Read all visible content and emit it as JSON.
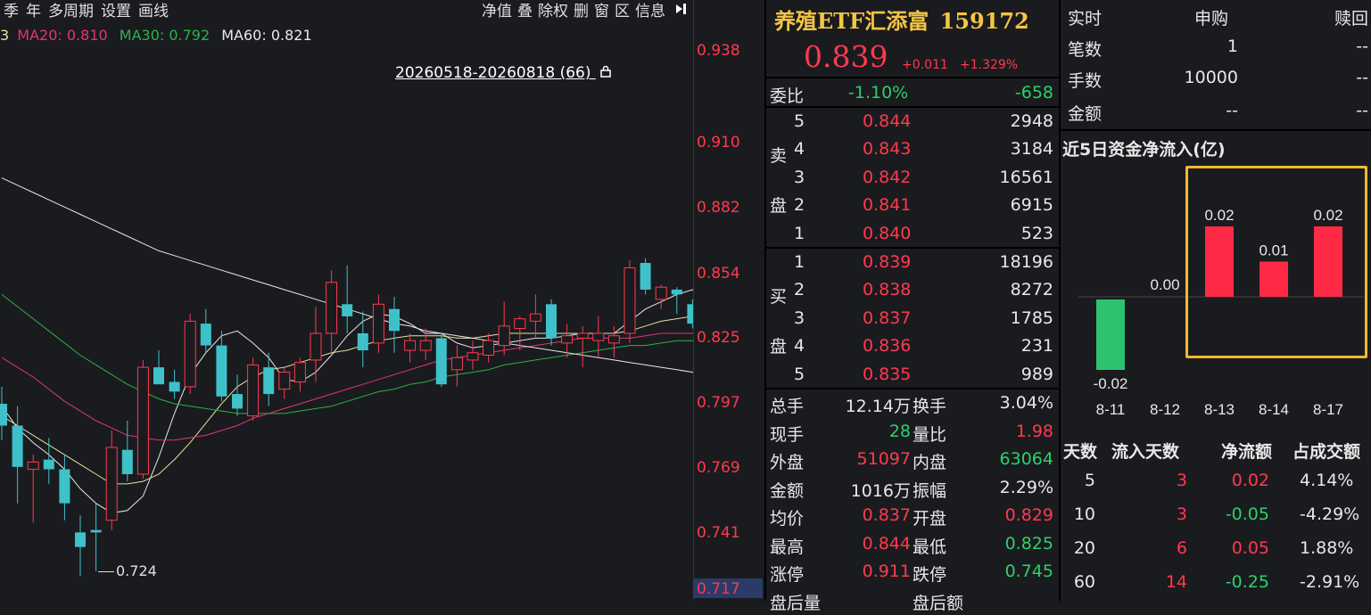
{
  "toolbar": {
    "left_items": [
      "季",
      "年",
      "多周期",
      "设置",
      "画线"
    ],
    "right_items": [
      "净值",
      "叠",
      "除权",
      "删",
      "窗",
      "区",
      "信息"
    ]
  },
  "ma": {
    "ma_prefix": "3",
    "ma20": "MA20: 0.810",
    "ma30": "MA30: 0.792",
    "ma60": "MA60: 0.821"
  },
  "chart": {
    "range_label": "20260518-20260818 (66)",
    "low_label": "0.724",
    "y_ticks": [
      "0.938",
      "0.910",
      "0.882",
      "0.854",
      "0.825",
      "0.797",
      "0.769",
      "0.741",
      "0.717"
    ]
  },
  "chart_data": {
    "type": "candlestick",
    "ylim": [
      0.717,
      0.945
    ],
    "candles": [
      {
        "o": 0.793,
        "h": 0.8,
        "l": 0.778,
        "c": 0.784
      },
      {
        "o": 0.784,
        "h": 0.792,
        "l": 0.752,
        "c": 0.767
      },
      {
        "o": 0.766,
        "h": 0.772,
        "l": 0.744,
        "c": 0.769
      },
      {
        "o": 0.77,
        "h": 0.779,
        "l": 0.76,
        "c": 0.766
      },
      {
        "o": 0.766,
        "h": 0.772,
        "l": 0.745,
        "c": 0.752
      },
      {
        "o": 0.74,
        "h": 0.747,
        "l": 0.722,
        "c": 0.734
      },
      {
        "o": 0.741,
        "h": 0.752,
        "l": 0.724,
        "c": 0.74
      },
      {
        "o": 0.745,
        "h": 0.782,
        "l": 0.741,
        "c": 0.775
      },
      {
        "o": 0.774,
        "h": 0.786,
        "l": 0.761,
        "c": 0.764
      },
      {
        "o": 0.764,
        "h": 0.811,
        "l": 0.762,
        "c": 0.808
      },
      {
        "o": 0.808,
        "h": 0.815,
        "l": 0.802,
        "c": 0.801
      },
      {
        "o": 0.802,
        "h": 0.807,
        "l": 0.795,
        "c": 0.798
      },
      {
        "o": 0.8,
        "h": 0.83,
        "l": 0.797,
        "c": 0.827
      },
      {
        "o": 0.826,
        "h": 0.832,
        "l": 0.814,
        "c": 0.817
      },
      {
        "o": 0.817,
        "h": 0.823,
        "l": 0.794,
        "c": 0.796
      },
      {
        "o": 0.797,
        "h": 0.805,
        "l": 0.788,
        "c": 0.791
      },
      {
        "o": 0.788,
        "h": 0.812,
        "l": 0.786,
        "c": 0.809
      },
      {
        "o": 0.808,
        "h": 0.814,
        "l": 0.792,
        "c": 0.797
      },
      {
        "o": 0.799,
        "h": 0.808,
        "l": 0.795,
        "c": 0.806
      },
      {
        "o": 0.802,
        "h": 0.812,
        "l": 0.798,
        "c": 0.81
      },
      {
        "o": 0.811,
        "h": 0.833,
        "l": 0.802,
        "c": 0.822
      },
      {
        "o": 0.822,
        "h": 0.848,
        "l": 0.813,
        "c": 0.843
      },
      {
        "o": 0.834,
        "h": 0.85,
        "l": 0.822,
        "c": 0.829
      },
      {
        "o": 0.822,
        "h": 0.831,
        "l": 0.808,
        "c": 0.815
      },
      {
        "o": 0.818,
        "h": 0.838,
        "l": 0.814,
        "c": 0.834
      },
      {
        "o": 0.832,
        "h": 0.837,
        "l": 0.814,
        "c": 0.823
      },
      {
        "o": 0.815,
        "h": 0.822,
        "l": 0.81,
        "c": 0.819
      },
      {
        "o": 0.815,
        "h": 0.824,
        "l": 0.811,
        "c": 0.819
      },
      {
        "o": 0.82,
        "h": 0.822,
        "l": 0.8,
        "c": 0.801
      },
      {
        "o": 0.807,
        "h": 0.817,
        "l": 0.8,
        "c": 0.812
      },
      {
        "o": 0.811,
        "h": 0.819,
        "l": 0.807,
        "c": 0.814
      },
      {
        "o": 0.813,
        "h": 0.822,
        "l": 0.81,
        "c": 0.819
      },
      {
        "o": 0.817,
        "h": 0.835,
        "l": 0.813,
        "c": 0.825
      },
      {
        "o": 0.824,
        "h": 0.829,
        "l": 0.815,
        "c": 0.828
      },
      {
        "o": 0.827,
        "h": 0.838,
        "l": 0.82,
        "c": 0.83
      },
      {
        "o": 0.834,
        "h": 0.836,
        "l": 0.817,
        "c": 0.82
      },
      {
        "o": 0.818,
        "h": 0.826,
        "l": 0.812,
        "c": 0.821
      },
      {
        "o": 0.82,
        "h": 0.825,
        "l": 0.808,
        "c": 0.822
      },
      {
        "o": 0.819,
        "h": 0.829,
        "l": 0.812,
        "c": 0.822
      },
      {
        "o": 0.818,
        "h": 0.825,
        "l": 0.812,
        "c": 0.821
      },
      {
        "o": 0.822,
        "h": 0.852,
        "l": 0.818,
        "c": 0.849
      },
      {
        "o": 0.851,
        "h": 0.853,
        "l": 0.838,
        "c": 0.84
      },
      {
        "o": 0.836,
        "h": 0.842,
        "l": 0.832,
        "c": 0.841
      },
      {
        "o": 0.84,
        "h": 0.841,
        "l": 0.83,
        "c": 0.838
      },
      {
        "o": 0.834,
        "h": 0.836,
        "l": 0.824,
        "c": 0.826
      },
      {
        "o": 0.825,
        "h": 0.833,
        "l": 0.82,
        "c": 0.829
      },
      {
        "o": 0.829,
        "h": 0.847,
        "l": 0.825,
        "c": 0.839
      }
    ],
    "ma_lines": [
      {
        "name": "MA5",
        "color": "#e8e8e8",
        "values": [
          0.792,
          0.783,
          0.777,
          0.772,
          0.766,
          0.758,
          0.752,
          0.748,
          0.749,
          0.755,
          0.771,
          0.789,
          0.805,
          0.814,
          0.821,
          0.823,
          0.818,
          0.812,
          0.803,
          0.802,
          0.806,
          0.813,
          0.821,
          0.827,
          0.83,
          0.829,
          0.826,
          0.822,
          0.822,
          0.818,
          0.816,
          0.817,
          0.818,
          0.819,
          0.82,
          0.82,
          0.821,
          0.822,
          0.822,
          0.822,
          0.827,
          0.832,
          0.835,
          0.838,
          0.84,
          0.836,
          0.834
        ]
      },
      {
        "name": "MA10",
        "color": "#e8e0a0",
        "values": [
          0.788,
          0.784,
          0.78,
          0.776,
          0.772,
          0.768,
          0.764,
          0.76,
          0.76,
          0.761,
          0.764,
          0.77,
          0.777,
          0.785,
          0.793,
          0.8,
          0.804,
          0.807,
          0.808,
          0.81,
          0.812,
          0.814,
          0.815,
          0.817,
          0.819,
          0.82,
          0.821,
          0.821,
          0.821,
          0.82,
          0.82,
          0.821,
          0.822,
          0.822,
          0.822,
          0.822,
          0.822,
          0.822,
          0.822,
          0.822,
          0.823,
          0.825,
          0.827,
          0.828,
          0.829,
          0.83,
          0.831
        ]
      },
      {
        "name": "MA20",
        "color": "#e0357a",
        "values": [
          0.812,
          0.808,
          0.804,
          0.799,
          0.794,
          0.79,
          0.786,
          0.783,
          0.78,
          0.779,
          0.778,
          0.778,
          0.779,
          0.78,
          0.782,
          0.784,
          0.787,
          0.789,
          0.791,
          0.793,
          0.795,
          0.797,
          0.799,
          0.801,
          0.803,
          0.805,
          0.807,
          0.809,
          0.811,
          0.812,
          0.813,
          0.814,
          0.815,
          0.816,
          0.817,
          0.818,
          0.819,
          0.82,
          0.82,
          0.82,
          0.82,
          0.821,
          0.822,
          0.822,
          0.822,
          0.822,
          0.823
        ]
      },
      {
        "name": "MA30",
        "color": "#29b34a",
        "values": [
          0.838,
          0.833,
          0.828,
          0.823,
          0.818,
          0.813,
          0.809,
          0.805,
          0.801,
          0.798,
          0.795,
          0.793,
          0.792,
          0.791,
          0.79,
          0.789,
          0.789,
          0.789,
          0.789,
          0.79,
          0.791,
          0.792,
          0.794,
          0.796,
          0.798,
          0.799,
          0.801,
          0.802,
          0.804,
          0.805,
          0.806,
          0.807,
          0.809,
          0.81,
          0.811,
          0.812,
          0.813,
          0.814,
          0.815,
          0.816,
          0.817,
          0.817,
          0.818,
          0.819,
          0.819,
          0.82,
          0.82
        ]
      },
      {
        "name": "MA60",
        "color": "#e8e8e8",
        "values": [
          0.886,
          0.883,
          0.88,
          0.877,
          0.874,
          0.871,
          0.868,
          0.865,
          0.862,
          0.859,
          0.856,
          0.854,
          0.852,
          0.85,
          0.848,
          0.846,
          0.844,
          0.842,
          0.84,
          0.838,
          0.836,
          0.834,
          0.832,
          0.83,
          0.828,
          0.826,
          0.825,
          0.823,
          0.822,
          0.821,
          0.82,
          0.819,
          0.818,
          0.817,
          0.816,
          0.815,
          0.814,
          0.813,
          0.812,
          0.811,
          0.81,
          0.809,
          0.808,
          0.807,
          0.806,
          0.805,
          0.804
        ]
      }
    ]
  },
  "quote": {
    "name": "养殖ETF汇添富",
    "code": "159172",
    "price": "0.839",
    "change": "+0.011",
    "change_pct": "+1.329%"
  },
  "order_ratio": {
    "label": "委比",
    "pct": "-1.10%",
    "diff": "-658"
  },
  "asks": {
    "side_label_1": "卖",
    "side_label_2": "盘",
    "rows": [
      {
        "level": "5",
        "price": "0.844",
        "volume": "2948"
      },
      {
        "level": "4",
        "price": "0.843",
        "volume": "3184"
      },
      {
        "level": "3",
        "price": "0.842",
        "volume": "16561"
      },
      {
        "level": "2",
        "price": "0.841",
        "volume": "6915"
      },
      {
        "level": "1",
        "price": "0.840",
        "volume": "523"
      }
    ]
  },
  "bids": {
    "side_label_1": "买",
    "side_label_2": "盘",
    "rows": [
      {
        "level": "1",
        "price": "0.839",
        "volume": "18196"
      },
      {
        "level": "2",
        "price": "0.838",
        "volume": "8272"
      },
      {
        "level": "3",
        "price": "0.837",
        "volume": "1785"
      },
      {
        "level": "4",
        "price": "0.836",
        "volume": "231"
      },
      {
        "level": "5",
        "price": "0.835",
        "volume": "989"
      }
    ]
  },
  "stats": [
    {
      "l1": "总手",
      "v1": "12.14万",
      "c1": "white",
      "l2": "换手",
      "v2": "3.04%",
      "c2": "white"
    },
    {
      "l1": "现手",
      "v1": "28",
      "c1": "green",
      "l2": "量比",
      "v2": "1.98",
      "c2": "red"
    },
    {
      "l1": "外盘",
      "v1": "51097",
      "c1": "red",
      "l2": "内盘",
      "v2": "63064",
      "c2": "green"
    },
    {
      "l1": "金额",
      "v1": "1016万",
      "c1": "white",
      "l2": "振幅",
      "v2": "2.29%",
      "c2": "white"
    },
    {
      "l1": "均价",
      "v1": "0.837",
      "c1": "red",
      "l2": "开盘",
      "v2": "0.829",
      "c2": "red"
    },
    {
      "l1": "最高",
      "v1": "0.844",
      "c1": "red",
      "l2": "最低",
      "v2": "0.825",
      "c2": "green"
    },
    {
      "l1": "涨停",
      "v1": "0.911",
      "c1": "red",
      "l2": "跌停",
      "v2": "0.745",
      "c2": "green"
    },
    {
      "l1": "盘后量",
      "v1": "",
      "c1": "white",
      "l2": "盘后额",
      "v2": "",
      "c2": "white"
    }
  ],
  "subscription": {
    "header": {
      "c0": "实时",
      "c1": "申购",
      "c2": "赎回"
    },
    "rows": [
      {
        "label": "笔数",
        "sub": "1",
        "red": "--"
      },
      {
        "label": "手数",
        "sub": "10000",
        "red": "--"
      },
      {
        "label": "金额",
        "sub": "--",
        "red": "--"
      }
    ]
  },
  "flow": {
    "title": "近5日资金净流入(亿)",
    "bars": [
      {
        "date": "8-11",
        "value": -0.02,
        "label": "-0.02"
      },
      {
        "date": "8-12",
        "value": 0.0,
        "label": "0.00"
      },
      {
        "date": "8-13",
        "value": 0.02,
        "label": "0.02"
      },
      {
        "date": "8-14",
        "value": 0.01,
        "label": "0.01"
      },
      {
        "date": "8-17",
        "value": 0.02,
        "label": "0.02"
      }
    ]
  },
  "flow_table": {
    "headers": [
      "天数",
      "流入天数",
      "净流额",
      "占成交额"
    ],
    "rows": [
      {
        "days": "5",
        "in_days": "3",
        "net": "0.02",
        "net_color": "red",
        "pct": "4.14%"
      },
      {
        "days": "10",
        "in_days": "3",
        "net": "-0.05",
        "net_color": "green",
        "pct": "-4.29%"
      },
      {
        "days": "20",
        "in_days": "6",
        "net": "0.05",
        "net_color": "red",
        "pct": "1.88%"
      },
      {
        "days": "60",
        "in_days": "14",
        "net": "-0.25",
        "net_color": "green",
        "pct": "-2.91%"
      }
    ]
  },
  "colors": {
    "up": "#ff3a4d",
    "down": "#2dd068",
    "hollow_down": "#3fc1c9",
    "highlight": "#f5b82e"
  }
}
